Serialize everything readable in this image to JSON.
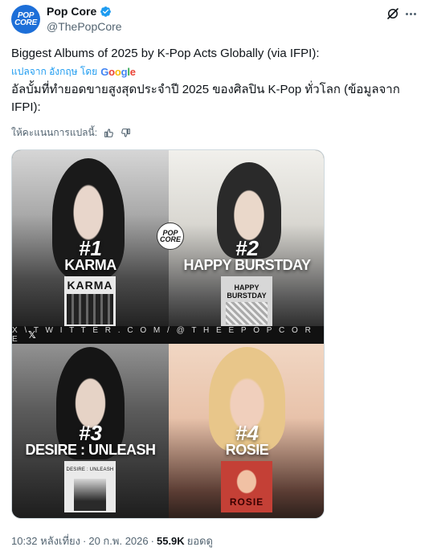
{
  "account": {
    "avatar_top": "POP",
    "avatar_bottom": "CORE",
    "display_name": "Pop Core",
    "handle": "@ThePopCore"
  },
  "tweet": {
    "text": "Biggest Albums of 2025 by K-Pop Acts Globally (via IFPI):",
    "translate_label": "แปลจาก อังกฤษ โดย",
    "translate_provider": "Google",
    "translated_text": "อัลบั้มที่ทำยอดขายสูงสุดประจำปี 2025 ของศิลปิน K-Pop ทั่วโลก (ข้อมูลจาก IFPI):",
    "rate_label": "ให้คะแนนการแปลนี้:"
  },
  "media": {
    "badge_top": "POP",
    "badge_bottom": "CORE",
    "watermark": "X \\ T W I T T E R . C O M / @ T H E E P O P C O R E",
    "x_mark": "𝕏",
    "albums": [
      {
        "rank": "#1",
        "title": "KARMA",
        "cover_text": "KARMA"
      },
      {
        "rank": "#2",
        "title": "HAPPY BURSTDAY",
        "cover_text": "HAPPY BURSTDAY"
      },
      {
        "rank": "#3",
        "title": "DESIRE : UNLEASH",
        "cover_text": "DESIRE : UNLEASH"
      },
      {
        "rank": "#4",
        "title": "ROSIE",
        "cover_text": "ROSIE"
      }
    ]
  },
  "footer": {
    "time": "10:32 หลังเที่ยง",
    "separator": "·",
    "date": "20 ก.พ. 2026",
    "separator2": "·",
    "views_count": "55.9K",
    "views_label": "ยอดดู"
  },
  "colors": {
    "accent": "#1d9bf0",
    "avatar_bg": "#1d6fd8",
    "text": "#0f1419",
    "muted": "#536471"
  }
}
